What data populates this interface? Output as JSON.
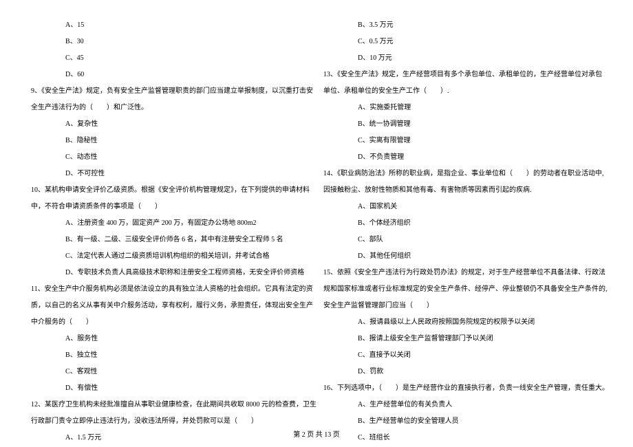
{
  "left_column": {
    "q8_options": [
      "A、15",
      "B、30",
      "C、45",
      "D、60"
    ],
    "q9_stem_line1": "9、《安全生产法》规定，负有安全生产监督管理职责的部门应当建立举报制度，以沉重打击安",
    "q9_stem_line2": "全生产违法行为的（　　）和广泛性。",
    "q9_options": [
      "A、复杂性",
      "B、隐秘性",
      "C、动态性",
      "D、不可控性"
    ],
    "q10_stem_line1": "10、某机构申请安全评价乙级资质。根据《安全评价机构管理规定》，在下列提供的申请材料",
    "q10_stem_line2": "中，不符合申请资质条件的事项是（　　）",
    "q10_options": [
      "A、注册资金 400 万，固定资产 200 万，有固定办公场地 800m2",
      "B、有一级、二级、三级安全评价师各 6 名，其中有注册安全工程师 5 名",
      "C、法定代表人通过二级资质培训机构组织的相关培训，并考试合格",
      "D、专职技术负责人具高级技术职称和注册安全工程师资格，无安全评价师资格"
    ],
    "q11_stem_line1": "11、安全生产中介服务机构必须是依法设立的具有独立法人资格的社会组织。它具有法定的资",
    "q11_stem_line2": "质，以自己的名义从事有关中介服务活动，享有权利，履行义务，承担责任，体现出安全生产",
    "q11_stem_line3": "中介服务的（　　）",
    "q11_options": [
      "A、服务性",
      "B、独立性",
      "C、客观性",
      "D、有偿性"
    ],
    "q12_stem_line1": "12、某医疗卫生机构未经批准擅自从事职业健康检查，在此期间共收取 8000 元的检查费，卫生",
    "q12_stem_line2": "行政部门责令立即停止违法行为，没收违法所得，并处罚款可以是（　　）",
    "q12_options_partial": [
      "A、1.5 万元"
    ]
  },
  "right_column": {
    "q12_options_rest": [
      "B、3.5 万元",
      "C、0.5 万元",
      "D、10 万元"
    ],
    "q13_stem_line1": "13、《安全生产法》规定，生产经营项目有多个承包单位、承租单位的，生产经营单位对承包",
    "q13_stem_line2": "单位、承租单位的安全生产工作（　　）.",
    "q13_options": [
      "A、实施委托管理",
      "B、统一协调管理",
      "C、实离有限管理",
      "D、不负责管理"
    ],
    "q14_stem_line1": "14、《职业病防治法》所称的职业病，是指企业、事业单位和（　　）的劳动者在职业活动中,",
    "q14_stem_line2": "因接触粉尘、放射性物质和其他有毒、有害物质等因素而引起的疾病.",
    "q14_options": [
      "A、国家机关",
      "B、个体经济组织",
      "C、部队",
      "D、其他任何组织"
    ],
    "q15_stem_line1": "15、依照《安全生产违法行为行政处罚办法》的规定，对于生产经营单位不具备法律、行政法",
    "q15_stem_line2": "规和国家标准或者行业标准规定的安全生产条件、经停产、停业整顿仍不具备安全生产条件的,",
    "q15_stem_line3": "安全生产监督管理部门应当（　　）",
    "q15_options": [
      "A、报请县级以上人民政府按照国务院规定的权限予以关闭",
      "B、报请上级安全生产监督管理部门予以关闭",
      "C、直接予以关闭",
      "D、罚款"
    ],
    "q16_stem_line1": "16、下列选项中，（　　）是生产经营作业的直接执行者，负责一线安全生产管理，责任重大。",
    "q16_options_partial": [
      "A、生产经营单位的有关负责人",
      "B、生产经营单位的安全管理人员",
      "C、班组长"
    ]
  },
  "footer": "第 2 页 共 13 页"
}
